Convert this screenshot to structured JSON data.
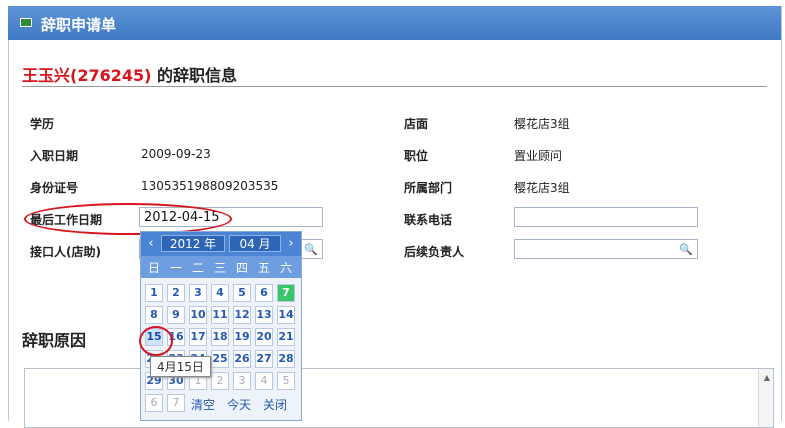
{
  "window": {
    "title": "辞职申请单"
  },
  "heading": {
    "name": "王玉兴(276245)",
    "suffix": " 的辞职信息"
  },
  "form": {
    "education_label": "学历",
    "hire_date_label": "入职日期",
    "hire_date_value": "2009-09-23",
    "id_label": "身份证号",
    "id_value": "130535198809203535",
    "last_day_label": "最后工作日期",
    "last_day_value": "2012-04-15",
    "contact_label": "接口人(店助)",
    "store_label": "店面",
    "store_value": "樱花店3组",
    "position_label": "职位",
    "position_value": "置业顾问",
    "dept_label": "所属部门",
    "dept_value": "樱花店3组",
    "phone_label": "联系电话",
    "successor_label": "后续负责人"
  },
  "reason": {
    "label": "辞职原因"
  },
  "calendar": {
    "prev": "‹",
    "next": "›",
    "year": "2012 年",
    "month": "04 月",
    "weekdays": [
      "日",
      "一",
      "二",
      "三",
      "四",
      "五",
      "六"
    ],
    "rows": [
      [
        "1",
        "2",
        "3",
        "4",
        "5",
        "6",
        "7"
      ],
      [
        "8",
        "9",
        "10",
        "11",
        "12",
        "13",
        "14"
      ],
      [
        "15",
        "16",
        "17",
        "18",
        "19",
        "20",
        "21"
      ],
      [
        "22",
        "23",
        "24",
        "25",
        "26",
        "27",
        "28"
      ],
      [
        "29",
        "30",
        "1",
        "2",
        "3",
        "4",
        "5"
      ],
      [
        "6",
        "7"
      ]
    ],
    "clear": "清空",
    "today": "今天",
    "close": "关闭",
    "tooltip": "4月15日",
    "today_day": "7",
    "selected_day": "15"
  },
  "icons": {
    "search": "search-icon"
  }
}
